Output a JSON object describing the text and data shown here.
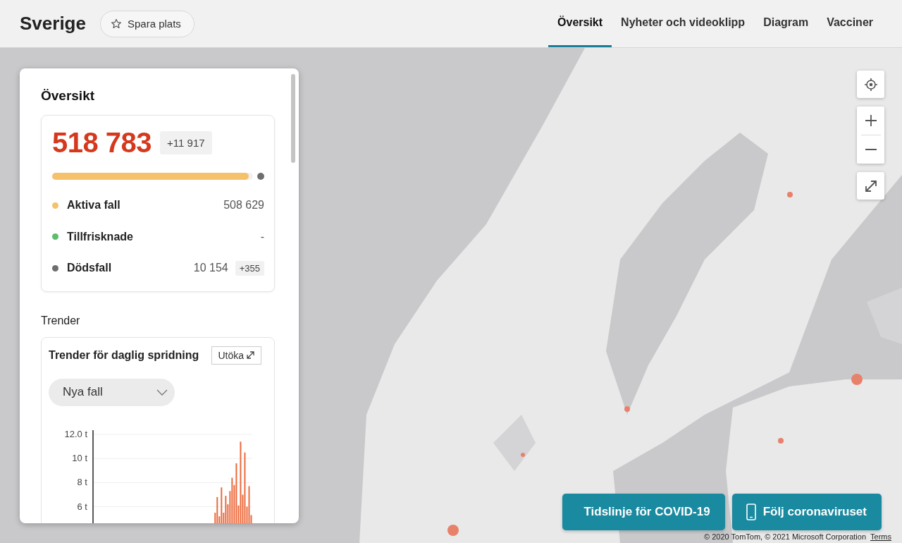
{
  "header": {
    "title": "Sverige",
    "save_button": "Spara plats",
    "tabs": [
      {
        "label": "Översikt",
        "selected": true
      },
      {
        "label": "Nyheter och videoklipp",
        "selected": false
      },
      {
        "label": "Diagram",
        "selected": false
      },
      {
        "label": "Vacciner",
        "selected": false
      }
    ]
  },
  "panel": {
    "title": "Översikt",
    "summary": {
      "total": "518 783",
      "total_change": "+11 917",
      "bar": {
        "level": 0.98
      },
      "rows": [
        {
          "label": "Aktiva fall",
          "value": "508 629",
          "color": "#f5c26b"
        },
        {
          "label": "Tillfrisknade",
          "value": "-",
          "color": "#5cbd6b"
        },
        {
          "label": "Dödsfall",
          "value": "10 154",
          "change": "+355",
          "color": "#6e6e6e"
        }
      ]
    },
    "trends": {
      "heading": "Trender",
      "card_title": "Trender för daglig spridning",
      "expand_button": "Utöka",
      "metric_dropdown": {
        "value": "Nya fall"
      },
      "chart_data": {
        "type": "bar",
        "grid": true,
        "ylim": [
          0,
          12
        ],
        "yticks": [
          {
            "value": 6,
            "label": "6 t"
          },
          {
            "value": 8,
            "label": "8 t"
          },
          {
            "value": 10,
            "label": "10 t"
          },
          {
            "value": 12,
            "label": "12.0 t"
          }
        ],
        "values": [
          null,
          null,
          null,
          null,
          null,
          null,
          null,
          null,
          null,
          null,
          null,
          null,
          null,
          null,
          null,
          null,
          null,
          null,
          null,
          null,
          null,
          null,
          null,
          null,
          null,
          null,
          null,
          null,
          null,
          null,
          null,
          null,
          null,
          null,
          null,
          null,
          null,
          null,
          null,
          null,
          null,
          null,
          null,
          null,
          null,
          null,
          null,
          null,
          null,
          null,
          null,
          null,
          null,
          null,
          null,
          null,
          null,
          5.5,
          6.8,
          5.2,
          7.6,
          5.5,
          6.9,
          6.2,
          7.3,
          8.4,
          7.8,
          9.6,
          6.1,
          11.4,
          7.0,
          10.5,
          6.0,
          7.7,
          5.3
        ]
      }
    }
  },
  "map": {
    "kind": "picture",
    "buttons": [
      {
        "label": "Tidslinje för COVID-19",
        "kind": "plain"
      },
      {
        "label": "Följ coronaviruset",
        "kind": "phone"
      }
    ],
    "attribution": "© 2020 TomTom, © 2021 Microsoft Corporation",
    "terms_link": "Terms"
  }
}
